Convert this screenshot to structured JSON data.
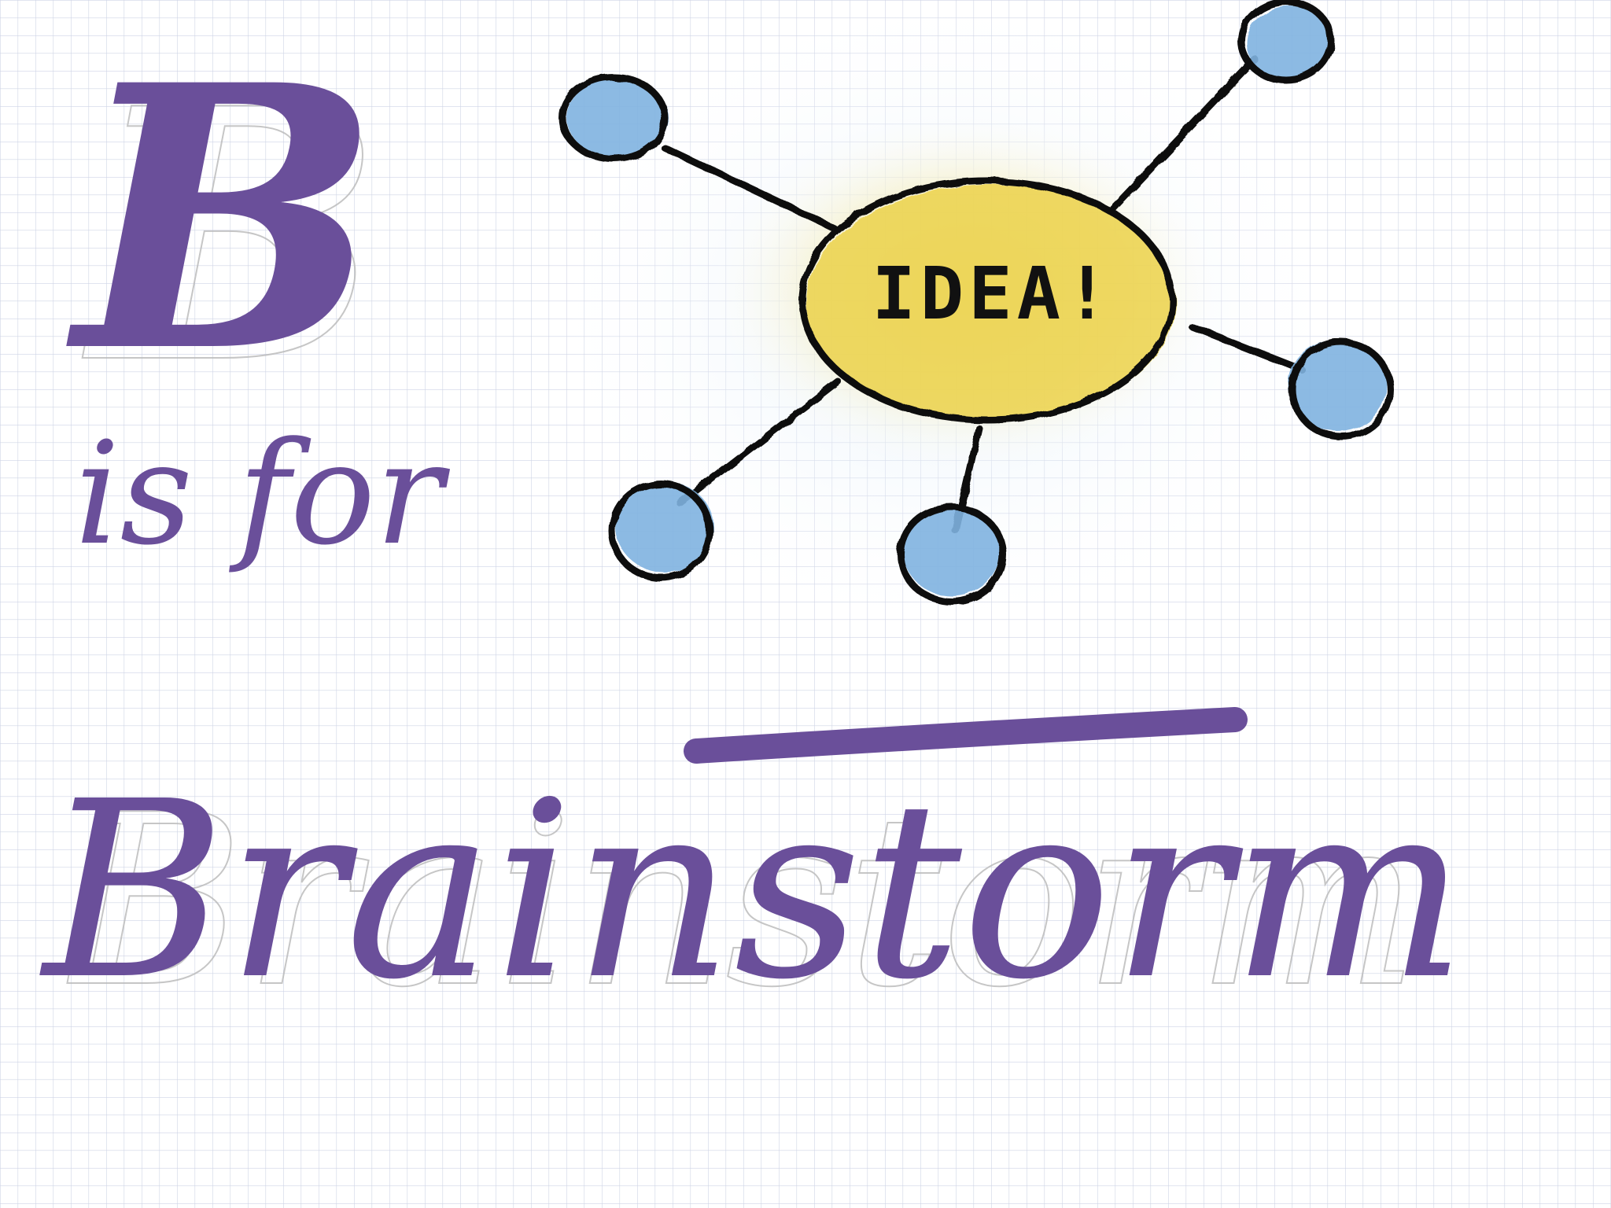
{
  "title": {
    "letter": "B",
    "connector": "is for",
    "word": "Brainstorm"
  },
  "mind_map": {
    "center_label": "IDEA!",
    "branch_count": 5
  },
  "colors": {
    "paper": "#ffffff",
    "grid_line": "#cfd4e6",
    "ink_purple": "#6a4f9a",
    "pencil_shadow": "#b8b8b8",
    "ink_black": "#111111",
    "idea_fill": "#ecd24a",
    "idea_glow": "#f6e9a6",
    "node_fill": "#7fb2e0",
    "node_glow": "#d6e8f6"
  }
}
